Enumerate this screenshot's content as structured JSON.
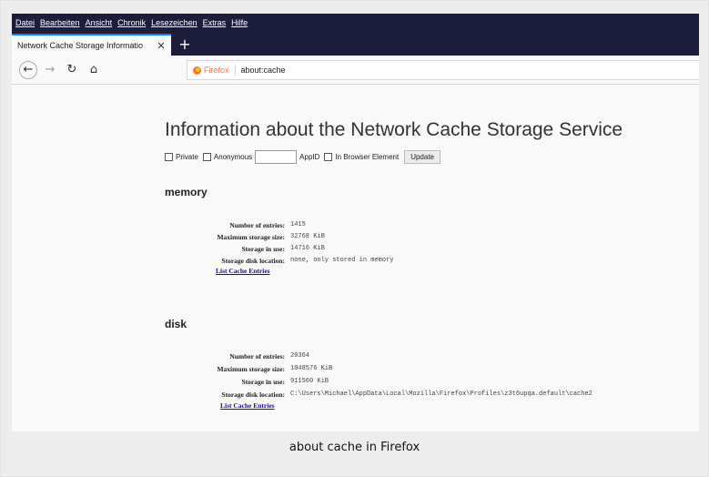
{
  "menubar": {
    "items": [
      "Datei",
      "Bearbeiten",
      "Ansicht",
      "Chronik",
      "Lesezeichen",
      "Extras",
      "Hilfe"
    ]
  },
  "tab": {
    "title": "Network Cache Storage Informatio",
    "close_glyph": "✕",
    "new_tab_glyph": "+"
  },
  "nav": {
    "back_glyph": "←",
    "forward_glyph": "→",
    "reload_glyph": "↻",
    "home_glyph": "⌂",
    "browser_name": "Firefox",
    "url": "about:cache"
  },
  "page": {
    "title": "Information about the Network Cache Storage Service",
    "controls": {
      "private_label": "Private",
      "anonymous_label": "Anonymous",
      "appid_label": "AppID",
      "in_browser_label": "In Browser Element",
      "update_label": "Update"
    },
    "sections": [
      {
        "title": "memory",
        "rows": [
          {
            "label": "Number of entries:",
            "value": "1415"
          },
          {
            "label": "Maximum storage size:",
            "value": "32768 KiB"
          },
          {
            "label": "Storage in use:",
            "value": "14716 KiB"
          },
          {
            "label": "Storage disk location:",
            "value": "none, only stored in memory"
          }
        ],
        "link": "List Cache Entries"
      },
      {
        "title": "disk",
        "rows": [
          {
            "label": "Number of entries:",
            "value": "20364"
          },
          {
            "label": "Maximum storage size:",
            "value": "1048576 KiB"
          },
          {
            "label": "Storage in use:",
            "value": "911560 KiB"
          },
          {
            "label": "Storage disk location:",
            "value": "C:\\Users\\Michael\\AppData\\Local\\Mozilla\\Firefox\\Profiles\\z3t6upqa.default\\cache2"
          }
        ],
        "link": "List Cache Entries"
      }
    ]
  },
  "caption": "about cache in Firefox",
  "colors": {
    "menubar_bg": "#1c1d3a",
    "tab_accent": "#0a84ff",
    "firefox_orange": "#ff7139",
    "link": "#1a0dab"
  }
}
